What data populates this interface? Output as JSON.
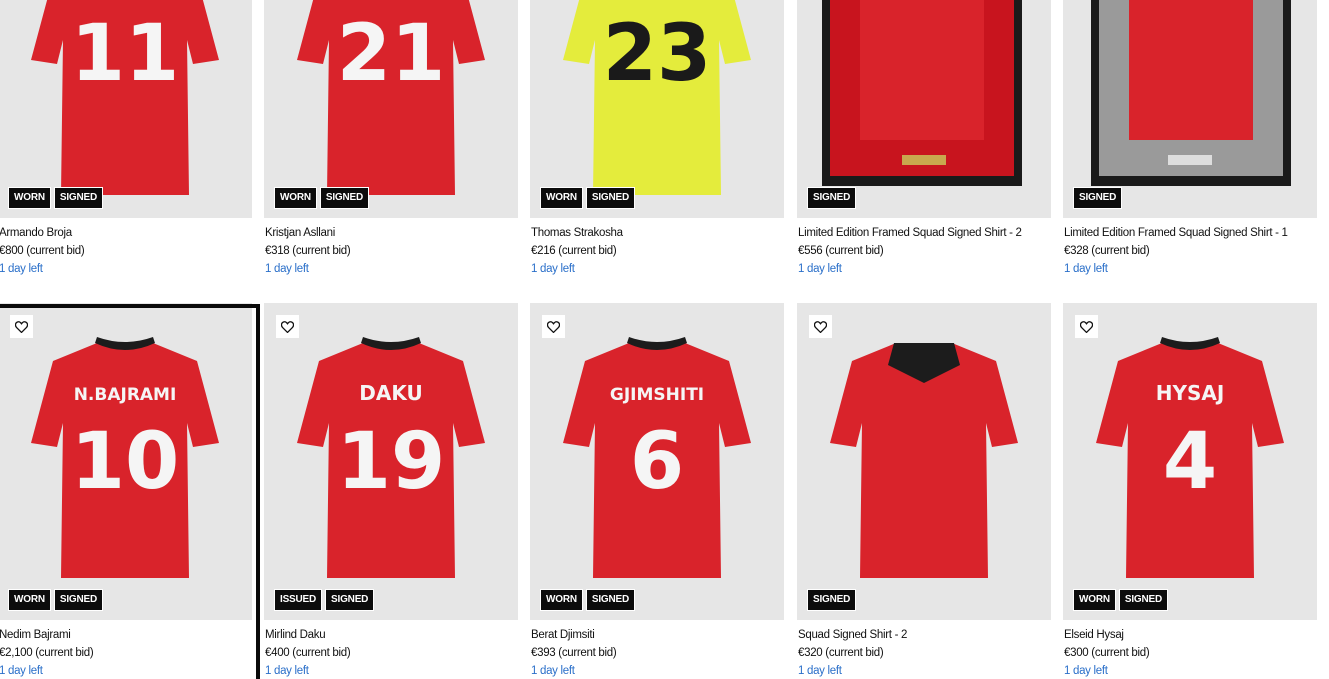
{
  "row1": [
    {
      "title": "Armando Broja",
      "price": "€800",
      "price_suffix": " (current bid)",
      "time": "1 day left",
      "badges": [
        "WORN",
        "SIGNED"
      ],
      "shirt_color": "#d9232b",
      "number": "11",
      "name": ""
    },
    {
      "title": "Kristjan Asllani",
      "price": "€318",
      "price_suffix": " (current bid)",
      "time": "1 day left",
      "badges": [
        "WORN",
        "SIGNED"
      ],
      "shirt_color": "#d9232b",
      "number": "21",
      "name": ""
    },
    {
      "title": "Thomas Strakosha",
      "price": "€216",
      "price_suffix": " (current bid)",
      "time": "1 day left",
      "badges": [
        "WORN",
        "SIGNED"
      ],
      "shirt_color": "#e4ec3c",
      "number": "23",
      "name": ""
    },
    {
      "title": "Limited Edition Framed Squad Signed Shirt - 2",
      "price": "€556",
      "price_suffix": " (current bid)",
      "time": "1 day left",
      "badges": [
        "SIGNED"
      ],
      "shirt_color": "#d9232b",
      "number": "",
      "name": ""
    },
    {
      "title": "Limited Edition Framed Squad Signed Shirt - 1",
      "price": "€328",
      "price_suffix": " (current bid)",
      "time": "1 day left",
      "badges": [
        "SIGNED"
      ],
      "shirt_color": "#d9232b",
      "number": "",
      "name": ""
    }
  ],
  "row2": [
    {
      "title": "Nedim Bajrami",
      "price": "€2,100",
      "price_suffix": " (current bid)",
      "time": "1 day left",
      "badges": [
        "WORN",
        "SIGNED"
      ],
      "shirt_color": "#d9232b",
      "number": "10",
      "name": "N.BAJRAMI"
    },
    {
      "title": "Mirlind Daku",
      "price": "€400",
      "price_suffix": " (current bid)",
      "time": "1 day left",
      "badges": [
        "ISSUED",
        "SIGNED"
      ],
      "shirt_color": "#d9232b",
      "number": "19",
      "name": "DAKU"
    },
    {
      "title": "Berat Djimsiti",
      "price": "€393",
      "price_suffix": " (current bid)",
      "time": "1 day left",
      "badges": [
        "WORN",
        "SIGNED"
      ],
      "shirt_color": "#d9232b",
      "number": "6",
      "name": "GJIMSHITI"
    },
    {
      "title": "Squad Signed Shirt - 2",
      "price": "€320",
      "price_suffix": " (current bid)",
      "time": "1 day left",
      "badges": [
        "SIGNED"
      ],
      "shirt_color": "#d9232b",
      "number": "",
      "name": ""
    },
    {
      "title": "Elseid Hysaj",
      "price": "€300",
      "price_suffix": " (current bid)",
      "time": "1 day left",
      "badges": [
        "WORN",
        "SIGNED"
      ],
      "shirt_color": "#d9232b",
      "number": "4",
      "name": "HYSAJ"
    }
  ],
  "icons": {
    "favorite": "heart-outline-icon"
  }
}
